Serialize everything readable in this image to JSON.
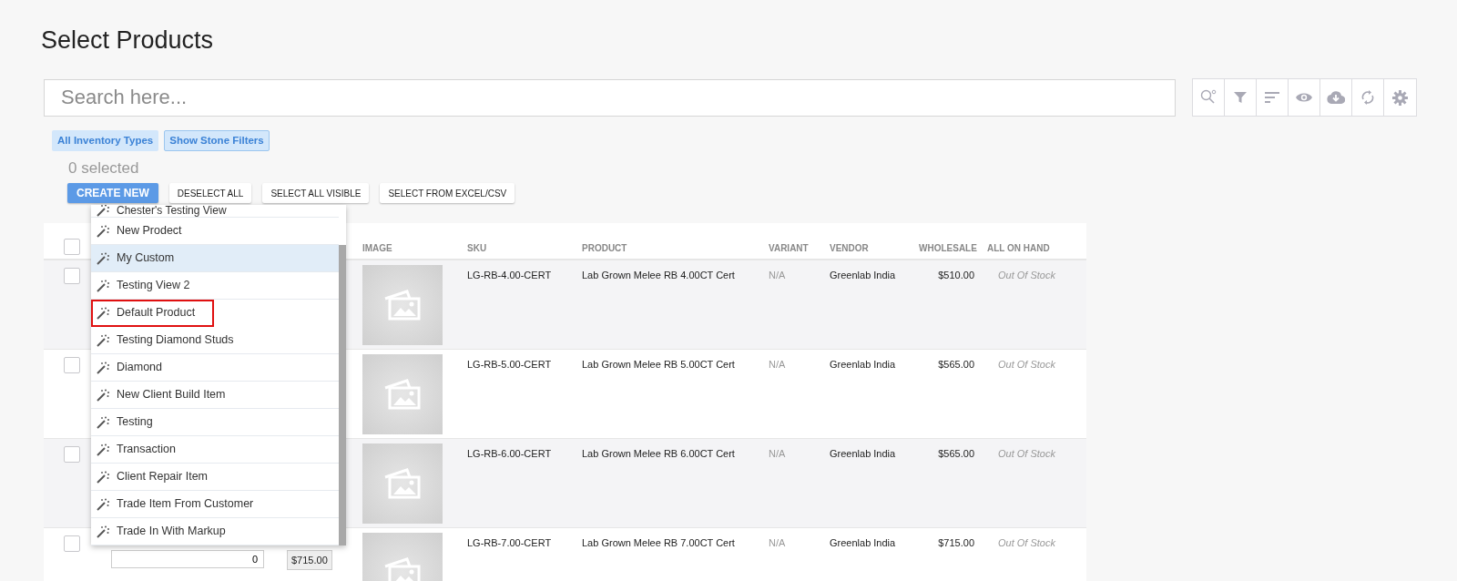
{
  "page": {
    "title": "Select Products"
  },
  "search": {
    "placeholder": "Search here..."
  },
  "toolbar": [
    {
      "kind": "search-settings"
    },
    {
      "kind": "filter"
    },
    {
      "kind": "sort"
    },
    {
      "kind": "view"
    },
    {
      "kind": "download"
    },
    {
      "kind": "refresh"
    },
    {
      "kind": "settings"
    }
  ],
  "filter_chips": [
    {
      "label": "All Inventory Types",
      "selected": false
    },
    {
      "label": "Show Stone Filters",
      "selected": true
    }
  ],
  "selection_count": "0 selected",
  "actions": [
    {
      "label": "CREATE NEW",
      "kind": "primary"
    },
    {
      "label": "DESELECT ALL",
      "kind": "default"
    },
    {
      "label": "SELECT ALL VISIBLE",
      "kind": "default"
    },
    {
      "label": "SELECT FROM EXCEL/CSV",
      "kind": "default"
    }
  ],
  "table": {
    "header_checked": false,
    "columns": [
      "IMAGE",
      "SKU",
      "PRODUCT",
      "VARIANT",
      "VENDOR",
      "WHOLESALE",
      "ALL ON HAND"
    ],
    "rows": [
      {
        "checked": false,
        "sku": "LG-RB-4.00-CERT",
        "product": "Lab Grown Melee RB 4.00CT Cert",
        "variant": "N/A",
        "vendor": "Greenlab India",
        "wholesale": "$510.00",
        "on_hand": "Out Of Stock"
      },
      {
        "checked": false,
        "sku": "LG-RB-5.00-CERT",
        "product": "Lab Grown Melee RB 5.00CT Cert",
        "variant": "N/A",
        "vendor": "Greenlab India",
        "wholesale": "$565.00",
        "on_hand": "Out Of Stock"
      },
      {
        "checked": false,
        "sku": "LG-RB-6.00-CERT",
        "product": "Lab Grown Melee RB 6.00CT Cert",
        "variant": "N/A",
        "vendor": "Greenlab India",
        "wholesale": "$565.00",
        "on_hand": "Out Of Stock"
      },
      {
        "checked": false,
        "quantity": "0",
        "price": "$715.00",
        "sku": "LG-RB-7.00-CERT",
        "product": "Lab Grown Melee RB 7.00CT Cert",
        "variant": "N/A",
        "vendor": "Greenlab India",
        "wholesale": "$715.00",
        "on_hand": "Out Of Stock"
      }
    ]
  },
  "dropdown": {
    "items": [
      {
        "label": "Chester's Testing View",
        "selected": false,
        "annotated": false
      },
      {
        "label": "New Prodect",
        "selected": false,
        "annotated": false
      },
      {
        "label": "My Custom",
        "selected": true,
        "annotated": false
      },
      {
        "label": "Testing View 2",
        "selected": false,
        "annotated": false
      },
      {
        "label": "Default Product",
        "selected": false,
        "annotated": true
      },
      {
        "label": "Testing Diamond Studs",
        "selected": false,
        "annotated": false
      },
      {
        "label": "Diamond",
        "selected": false,
        "annotated": false
      },
      {
        "label": "New Client Build Item",
        "selected": false,
        "annotated": false
      },
      {
        "label": "Testing",
        "selected": false,
        "annotated": false
      },
      {
        "label": "Transaction",
        "selected": false,
        "annotated": false
      },
      {
        "label": "Client Repair Item",
        "selected": false,
        "annotated": false
      },
      {
        "label": "Trade Item From Customer",
        "selected": false,
        "annotated": false
      },
      {
        "label": "Trade In With Markup",
        "selected": false,
        "annotated": false
      }
    ]
  }
}
